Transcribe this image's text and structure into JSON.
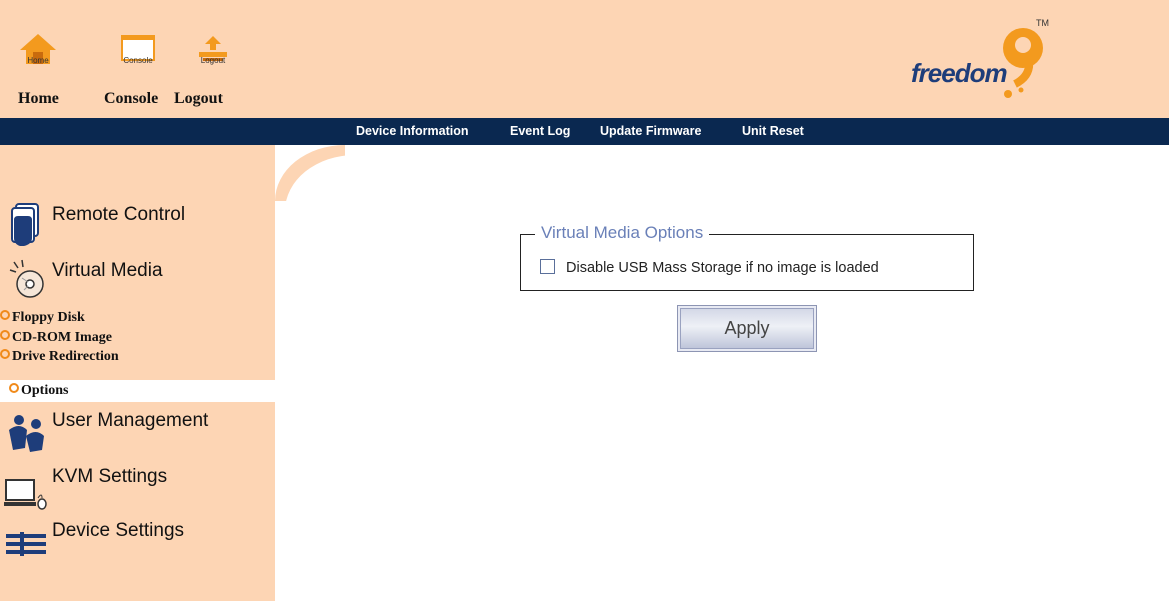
{
  "toolbar": {
    "home": {
      "small_label": "Home",
      "label": "Home"
    },
    "console": {
      "small_label": "Console",
      "label": "Console"
    },
    "logout": {
      "small_label": "Logout",
      "label": "Logout"
    }
  },
  "logo": {
    "text": "freedom",
    "mark": "9",
    "tm": "TM"
  },
  "nav": {
    "device_information": "Device Information",
    "event_log": "Event Log",
    "update_firmware": "Update Firmware",
    "unit_reset": "Unit Reset"
  },
  "sidebar": {
    "remote_control": "Remote Control",
    "virtual_media": "Virtual Media",
    "floppy_disk": "Floppy Disk",
    "cdrom_image": "CD-ROM Image",
    "drive_redirection": "Drive Redirection",
    "options": "Options",
    "user_management": "User Management",
    "kvm_settings": "KVM Settings",
    "device_settings": "Device Settings"
  },
  "main": {
    "fieldset_legend": "Virtual Media Options",
    "checkbox_label": "Disable USB Mass Storage if no image is loaded",
    "checkbox_checked": false,
    "apply_label": "Apply"
  },
  "colors": {
    "accent_bg": "#fdd5b4",
    "navbar": "#0a2850",
    "legend": "#6a80b8",
    "logo_orange": "#f39a1e",
    "logo_blue": "#1e3d7a"
  }
}
